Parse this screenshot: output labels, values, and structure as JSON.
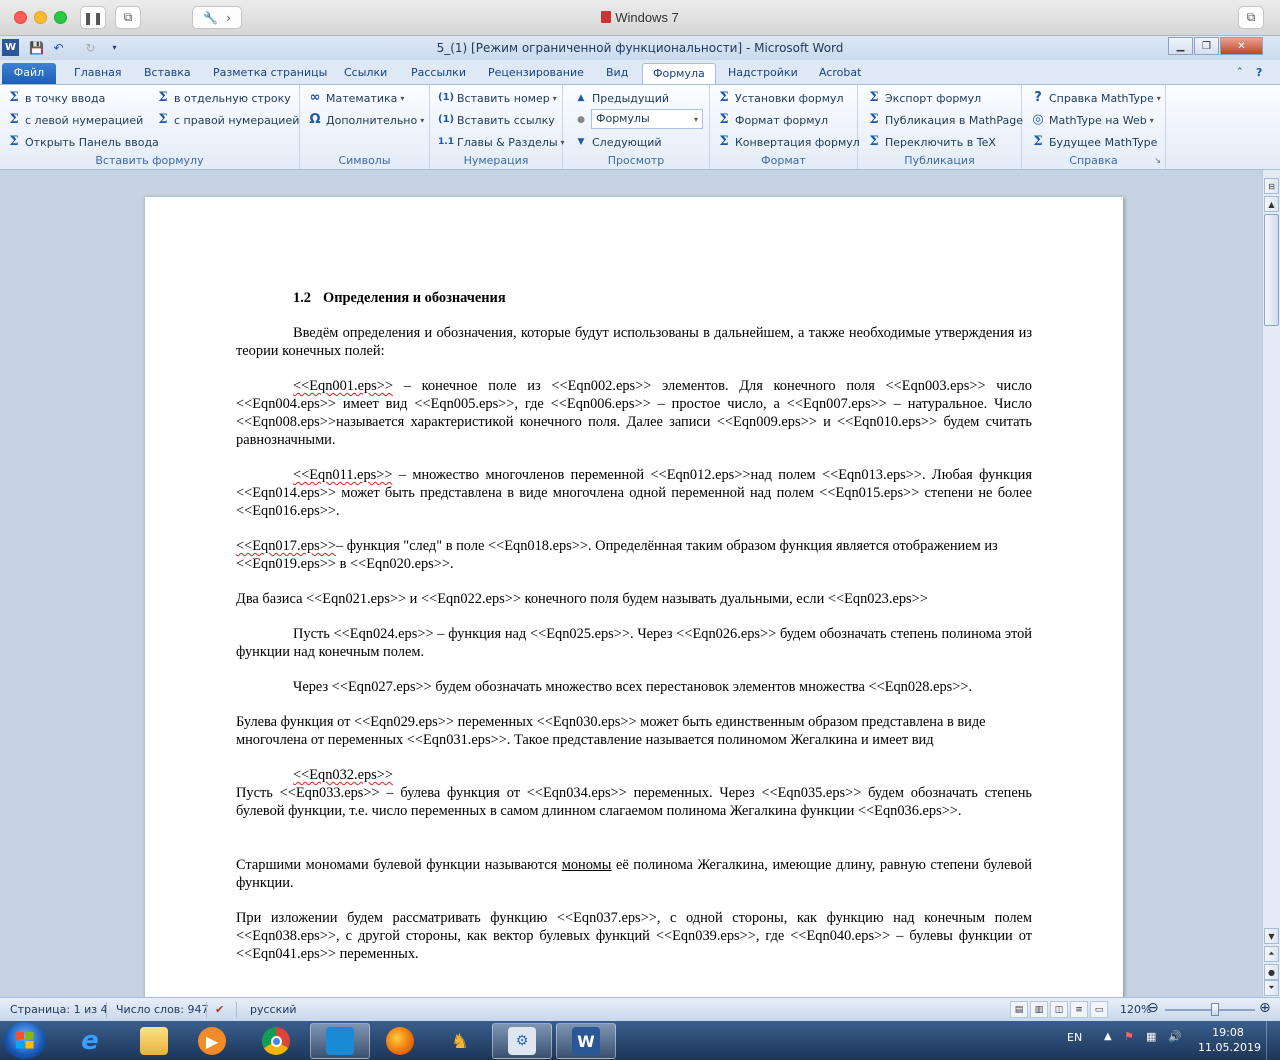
{
  "host": {
    "title": "Windows 7"
  },
  "word": {
    "title": "5_(1) [Режим ограниченной функциональности]  -  Microsoft Word"
  },
  "tabs": [
    {
      "label": "Файл"
    },
    {
      "label": "Главная"
    },
    {
      "label": "Вставка"
    },
    {
      "label": "Разметка страницы"
    },
    {
      "label": "Ссылки"
    },
    {
      "label": "Рассылки"
    },
    {
      "label": "Рецензирование"
    },
    {
      "label": "Вид"
    },
    {
      "label": "Формула"
    },
    {
      "label": "Надстройки"
    },
    {
      "label": "Acrobat"
    }
  ],
  "ribbon": {
    "insert": {
      "label": "Вставить формулу",
      "inline": "в точку ввода",
      "display": "в отдельную строку",
      "left_num": "с левой нумерацией",
      "right_num": "с правой нумерацией",
      "open_panel": "Открыть Панель ввода"
    },
    "symbols": {
      "label": "Символы",
      "math": "Математика",
      "more": "Дополнительно"
    },
    "numbering": {
      "label": "Нумерация",
      "insert_number": "Вставить номер",
      "insert_ref": "Вставить ссылку",
      "chapters": "Главы & Разделы"
    },
    "browse": {
      "label": "Просмотр",
      "prev": "Предыдущий",
      "combo_value": "Формулы",
      "next": "Следующий"
    },
    "format": {
      "label": "Формат",
      "settings": "Установки формул",
      "format": "Формат формул",
      "convert": "Конвертация формул"
    },
    "publish": {
      "label": "Публикация",
      "export": "Экспорт формул",
      "mathpage": "Публикация в MathPage",
      "tex": "Переключить в TeX"
    },
    "help": {
      "label": "Справка",
      "mt_help": "Справка MathType",
      "mt_web": "MathType на Web",
      "future": "Будущее MathType"
    }
  },
  "document": {
    "heading_num": "1.2",
    "heading_text": "Определения и обозначения",
    "p1": "Введём определения и обозначения, которые будут использованы в дальнейшем, а также необходимые утверждения из теории конечных полей:",
    "p2a": "<<Eqn001.eps>>",
    "p2b": " – конечное поле из <<Eqn002.eps>> элементов. Для конечного поля <<Eqn003.eps>> число <<Eqn004.eps>> имеет вид <<Eqn005.eps>>, где <<Eqn006.eps>> – простое число, а <<Eqn007.eps>> – натуральное. Число <<Eqn008.eps>>называется характеристикой конечного поля. Далее записи <<Eqn009.eps>> и <<Eqn010.eps>>  будем считать равнозначными.",
    "p3a": "<<Eqn011.eps>>",
    "p3b": " – множество многочленов переменной <<Eqn012.eps>>над полем <<Eqn013.eps>>. Любая функция <<Eqn014.eps>> может быть представлена в виде многочлена одной переменной над полем <<Eqn015.eps>> степени не более <<Eqn016.eps>>.",
    "p4a": "<<Eqn017.eps>>",
    "p4b": "– функция \"след\" в поле <<Eqn018.eps>>. Определённая таким образом функция является отображением из <<Eqn019.eps>> в <<Eqn020.eps>>.",
    "p5": "Два базиса <<Eqn021.eps>> и <<Eqn022.eps>> конечного поля будем называть дуальными, если <<Eqn023.eps>>",
    "p6": "Пусть <<Eqn024.eps>> – функция над <<Eqn025.eps>>. Через <<Eqn026.eps>> будем обозначать степень полинома этой функции над конечным полем.",
    "p7": "Через <<Eqn027.eps>> будем обозначать множество всех перестановок элементов множества <<Eqn028.eps>>.",
    "p8": "Булева функция от <<Eqn029.eps>> переменных <<Eqn030.eps>> может быть единственным образом представлена в виде многочлена от переменных <<Eqn031.eps>>. Такое представление называется полиномом Жегалкина и имеет вид",
    "p9": "<<Eqn032.eps>>",
    "p10": "Пусть <<Eqn033.eps>> – булева функция от <<Eqn034.eps>> переменных. Через <<Eqn035.eps>> будем обозначать степень булевой функции, т.е. число переменных в самом длинном слагаемом полинома Жегалкина функции <<Eqn036.eps>>.",
    "p11a": "Старшими мономами булевой функции называются ",
    "p11b": "мономы",
    "p11c": " её полинома Жегалкина, имеющие длину, равную степени булевой функции.",
    "p12": "При изложении будем рассматривать функцию <<Eqn037.eps>>, с одной стороны, как функцию над конечным полем <<Eqn038.eps>>, с другой стороны, как вектор булевых функций <<Eqn039.eps>>, где <<Eqn040.eps>> – булевы функции от <<Eqn041.eps>> переменных."
  },
  "status": {
    "page": "Страница: 1 из 4",
    "words": "Число слов: 947",
    "lang": "русский",
    "zoom": "120%",
    "zoom_level": 0.55
  },
  "taskbar": {
    "input_lang": "EN",
    "time": "19:08",
    "date": "11.05.2019"
  },
  "colors": {
    "ribbon_accent": "#1b5fb5",
    "doc_background": "#c7d3e2",
    "spell_underline": "#e02020"
  }
}
